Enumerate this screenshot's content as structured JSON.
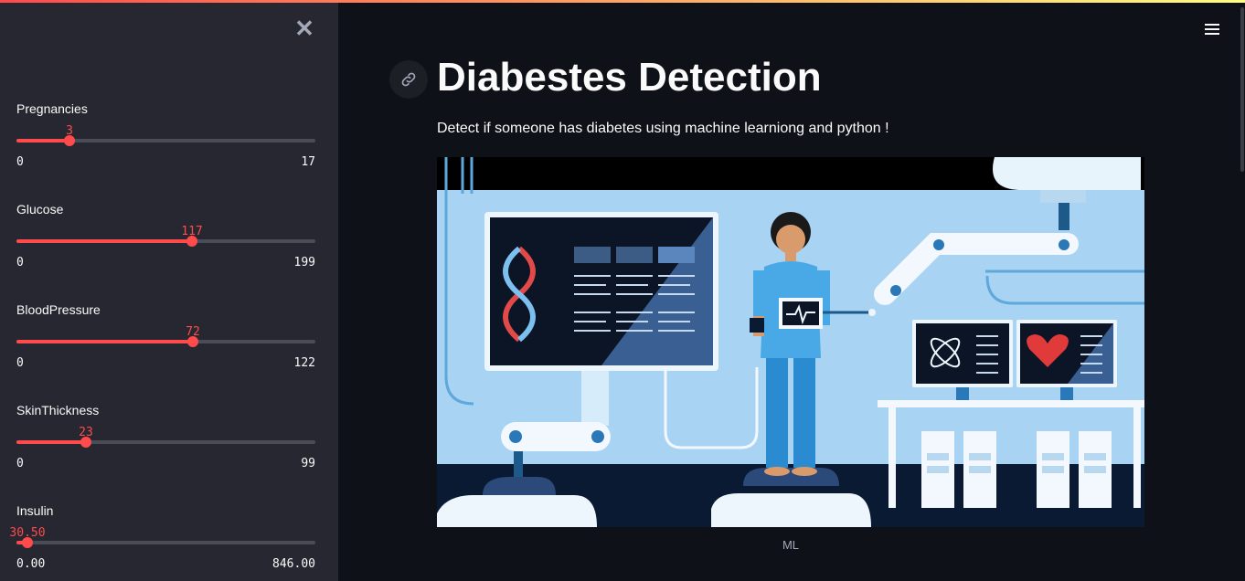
{
  "app": {
    "title": "Diabestes Detection",
    "subtitle": "Detect if someone has diabetes using machine learniong and python !",
    "image_caption": "ML"
  },
  "sidebar": {
    "sliders": [
      {
        "label": "Pregnancies",
        "value": "3",
        "min": "0",
        "max": "17",
        "fraction": 0.1765
      },
      {
        "label": "Glucose",
        "value": "117",
        "min": "0",
        "max": "199",
        "fraction": 0.588
      },
      {
        "label": "BloodPressure",
        "value": "72",
        "min": "0",
        "max": "122",
        "fraction": 0.59
      },
      {
        "label": "SkinThickness",
        "value": "23",
        "min": "0",
        "max": "99",
        "fraction": 0.2323
      },
      {
        "label": "Insulin",
        "value": "30.50",
        "min": "0.00",
        "max": "846.00",
        "fraction": 0.036
      }
    ]
  },
  "colors": {
    "accent": "#ff4b4b",
    "background": "#0e1117",
    "sidebar": "#262730"
  },
  "icons": {
    "close": "close-icon",
    "menu": "hamburger-menu-icon",
    "anchor": "link-icon"
  }
}
